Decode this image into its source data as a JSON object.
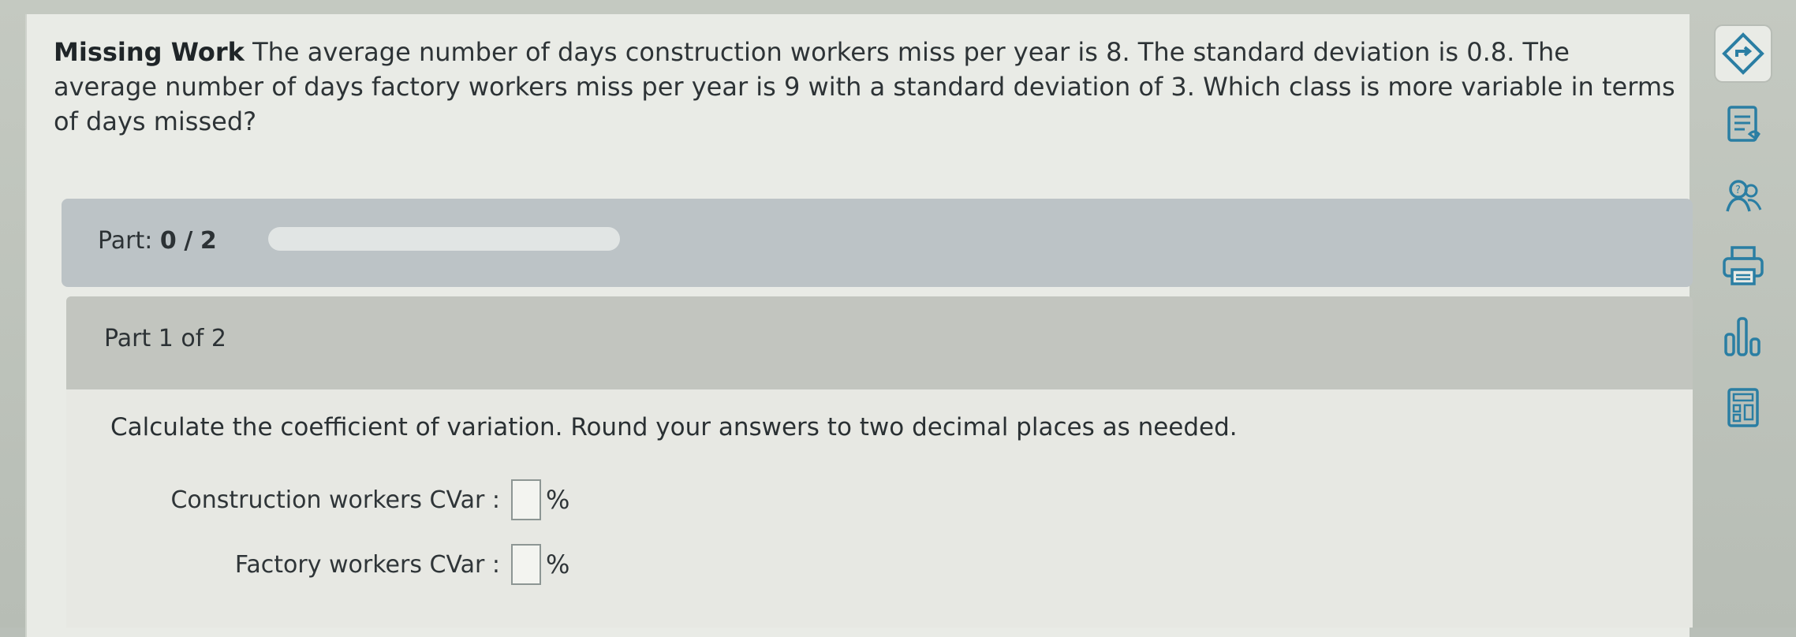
{
  "question": {
    "title": "Missing Work",
    "text": "The average number of days construction workers miss per year is 8. The standard deviation is 0.8. The average number of days factory workers miss per year is 9 with a standard deviation of 3. Which class is more variable in terms of days missed?"
  },
  "progress": {
    "label": "Part:",
    "current": "0",
    "separator": "/",
    "total": "2",
    "fraction": 0
  },
  "part": {
    "header": "Part 1 of 2",
    "instruction": "Calculate the coefficient of variation. Round your answers to two decimal places as needed.",
    "fields": [
      {
        "label": "Construction workers CVar :",
        "value": "",
        "unit": "%"
      },
      {
        "label": "Factory workers CVar :",
        "value": "",
        "unit": "%"
      }
    ]
  },
  "toolbar": {
    "icons": [
      "diamond-arrow-icon",
      "notes-icon",
      "people-help-icon",
      "print-icon",
      "chart-icon",
      "calculator-icon"
    ]
  },
  "colors": {
    "accent": "#2a7ea3",
    "progress_bar": "#bcc3c6",
    "part_header": "#c2c5bf"
  }
}
